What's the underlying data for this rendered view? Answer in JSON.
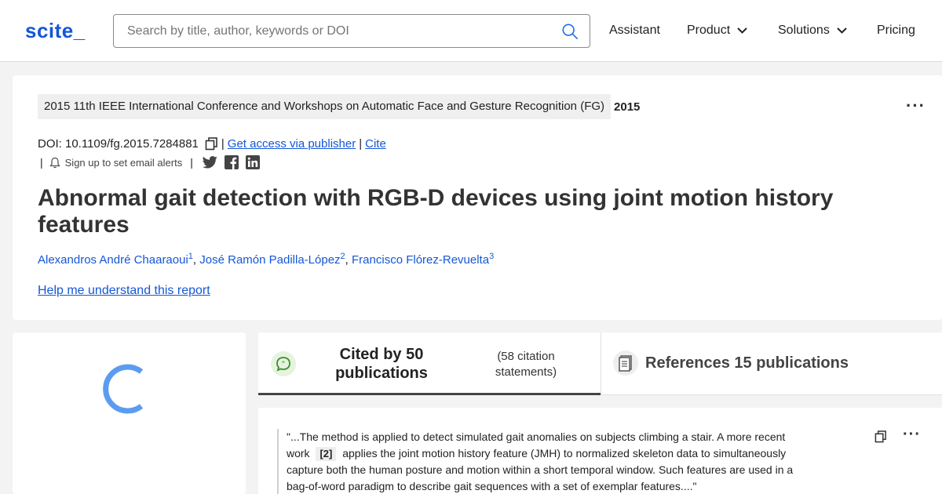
{
  "header": {
    "logo": "scite_",
    "search": {
      "placeholder": "Search by title, author, keywords or DOI",
      "value": ""
    },
    "nav": [
      {
        "label": "Assistant"
      },
      {
        "label": "Product"
      },
      {
        "label": "Solutions"
      },
      {
        "label": "Pricing"
      }
    ]
  },
  "publication": {
    "venue": "2015 11th IEEE International Conference and Workshops on Automatic Face and Gesture Recognition (FG)",
    "year": "2015",
    "doi": "DOI: 10.1109/fg.2015.7284881",
    "access_link": "Get access via publisher",
    "cite_link": "Cite",
    "alerts": "Sign up to set email alerts",
    "title": "Abnormal gait detection with RGB-D devices using joint motion history features",
    "authors": [
      {
        "name": "Alexandros André Chaaraoui",
        "sup": "1"
      },
      {
        "name": "José Ramón Padilla-López",
        "sup": "2"
      },
      {
        "name": "Francisco Flórez-Revuelta",
        "sup": "3"
      }
    ],
    "help_link": "Help me understand this report"
  },
  "tabs": {
    "cited": {
      "label": "Cited by 50 publications",
      "statements": "(58 citation statements)"
    },
    "references": {
      "label": "References 15 publications"
    }
  },
  "citation": {
    "text_before": "\"...The method is applied to detect simulated gait anomalies on subjects climbing a stair. A more recent work",
    "ref": "[2]",
    "text_after": "applies the joint motion history feature (JMH) to normalized skeleton data to simultaneously capture both the human posture and motion within a short temporal window. Such features are used in a bag-of-word paradigm to describe gait sequences with a set of exemplar features....\""
  },
  "colors": {
    "accent": "#1457d6",
    "loader": "#5b9cf0",
    "cited_icon": "#3a8f2c"
  },
  "icons": [
    "search-icon",
    "chevron-down-icon",
    "copy-icon",
    "bell-icon",
    "twitter-icon",
    "facebook-icon",
    "linkedin-icon",
    "more-icon",
    "speech-bubble-icon",
    "document-icon",
    "loading-spinner"
  ]
}
